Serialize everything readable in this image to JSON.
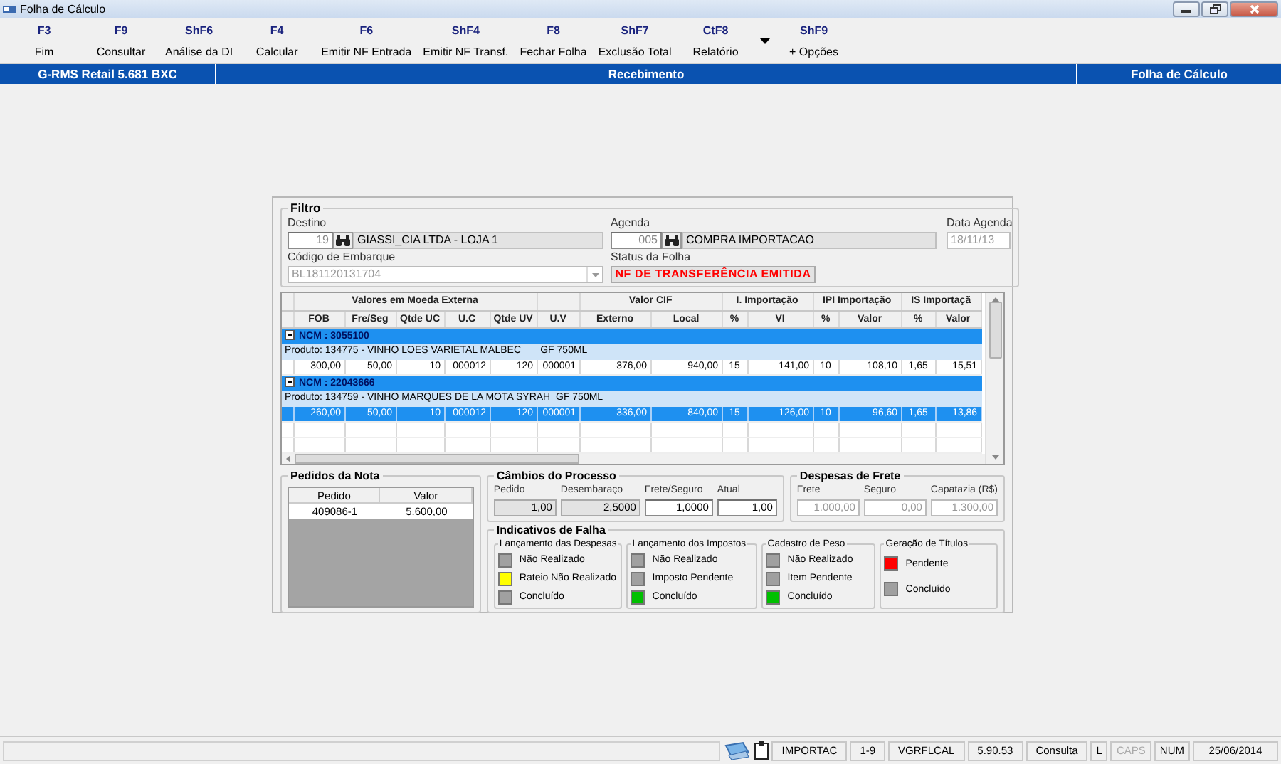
{
  "window": {
    "title": "Folha de Cálculo"
  },
  "toolbar": [
    {
      "key": "F3",
      "label": "Fim",
      "has_menu": false
    },
    {
      "key": "F9",
      "label": "Consultar",
      "has_menu": false
    },
    {
      "key": "ShF6",
      "label": "Análise da DI",
      "has_menu": false
    },
    {
      "key": "F4",
      "label": "Calcular",
      "has_menu": false
    },
    {
      "key": "F6",
      "label": "Emitir NF Entrada",
      "has_menu": false
    },
    {
      "key": "ShF4",
      "label": "Emitir NF Transf.",
      "has_menu": false
    },
    {
      "key": "F8",
      "label": "Fechar Folha",
      "has_menu": false
    },
    {
      "key": "ShF7",
      "label": "Exclusão Total",
      "has_menu": false
    },
    {
      "key": "CtF8",
      "label": "Relatório",
      "has_menu": true
    },
    {
      "key": "ShF9",
      "label": "+ Opções",
      "has_menu": false
    }
  ],
  "header": {
    "left": "G-RMS Retail 5.681 BXC",
    "center": "Recebimento",
    "right": "Folha de Cálculo"
  },
  "filter": {
    "title": "Filtro",
    "destino": {
      "label": "Destino",
      "code": "19",
      "name": "GIASSI_CIA LTDA - LOJA 1"
    },
    "agenda": {
      "label": "Agenda",
      "code": "005",
      "name": "COMPRA IMPORTACAO"
    },
    "data_agenda": {
      "label": "Data Agenda",
      "value": "18/11/13"
    },
    "embarque": {
      "label": "Código de Embarque",
      "value": "BL181120131704"
    },
    "status": {
      "label": "Status da Folha",
      "value": "NF DE TRANSFERÊNCIA EMITIDA"
    }
  },
  "grid": {
    "groups": [
      {
        "label": "Valores em Moeda Externa",
        "columns": [
          "FOB",
          "Fre/Seg",
          "Qtde UC",
          "U.C",
          "Qtde UV"
        ]
      },
      {
        "columns": [
          "U.V"
        ]
      },
      {
        "label": "Valor CIF",
        "columns": [
          "Externo",
          "Local"
        ]
      },
      {
        "label": "I. Importação",
        "columns": [
          "%",
          "VI"
        ]
      },
      {
        "label": "IPI Importação",
        "columns": [
          "%",
          "Valor"
        ]
      },
      {
        "label": "IS Importaçã",
        "columns": [
          "%",
          "Valor"
        ]
      }
    ],
    "rows": [
      {
        "kind": "group",
        "label": "NCM : 3055100",
        "expanded": true
      },
      {
        "kind": "product",
        "label": "Produto: 134775 - VINHO LOES VARIETAL MALBEC       GF 750ML"
      },
      {
        "kind": "data",
        "selected": false,
        "cells": [
          "300,00",
          "50,00",
          "10",
          "000012",
          "120",
          "000001",
          "376,00",
          "940,00",
          "15",
          "141,00",
          "10",
          "108,10",
          "1,65",
          "15,51"
        ]
      },
      {
        "kind": "group",
        "label": "NCM : 22043666",
        "expanded": true
      },
      {
        "kind": "product",
        "label": "Produto: 134759 - VINHO MARQUES DE LA MOTA SYRAH  GF 750ML"
      },
      {
        "kind": "data",
        "selected": true,
        "cells": [
          "260,00",
          "50,00",
          "10",
          "000012",
          "120",
          "000001",
          "336,00",
          "840,00",
          "15",
          "126,00",
          "10",
          "96,60",
          "1,65",
          "13,86"
        ]
      }
    ]
  },
  "pedidos": {
    "title": "Pedidos da Nota",
    "columns": [
      "Pedido",
      "Valor"
    ],
    "rows": [
      [
        "409086-1",
        "5.600,00"
      ]
    ]
  },
  "cambios": {
    "title": "Câmbios do Processo",
    "fields": [
      {
        "label": "Pedido",
        "value": "1,00",
        "readonly": true
      },
      {
        "label": "Desembaraço",
        "value": "2,5000",
        "readonly": true
      },
      {
        "label": "Frete/Seguro",
        "value": "1,0000",
        "readonly": false
      },
      {
        "label": "Atual",
        "value": "1,00",
        "readonly": false
      }
    ]
  },
  "despesas": {
    "title": "Despesas de Frete",
    "fields": [
      {
        "label": "Frete",
        "value": "1.000,00",
        "disabled": true
      },
      {
        "label": "Seguro",
        "value": "0,00",
        "disabled": true
      },
      {
        "label": "Capatazia (R$)",
        "value": "1.300,00",
        "disabled": true
      }
    ]
  },
  "indicativos": {
    "title": "Indicativos de Falha",
    "groups": [
      {
        "title": "Lançamento das Despesas",
        "items": [
          {
            "label": "Não Realizado",
            "color": "#a0a0a0"
          },
          {
            "label": "Rateio Não Realizado",
            "color": "#ffff00"
          },
          {
            "label": "Concluído",
            "color": "#a0a0a0"
          }
        ]
      },
      {
        "title": "Lançamento dos Impostos",
        "items": [
          {
            "label": "Não Realizado",
            "color": "#a0a0a0"
          },
          {
            "label": "Imposto Pendente",
            "color": "#a0a0a0"
          },
          {
            "label": "Concluído",
            "color": "#00c000"
          }
        ]
      },
      {
        "title": "Cadastro de Peso",
        "items": [
          {
            "label": "Não Realizado",
            "color": "#a0a0a0"
          },
          {
            "label": "Item Pendente",
            "color": "#a0a0a0"
          },
          {
            "label": "Concluído",
            "color": "#00c000"
          }
        ]
      },
      {
        "title": "Geração de Títulos",
        "items": [
          {
            "label": "Pendente",
            "color": "#ff0000"
          },
          {
            "label": "Concluído",
            "color": "#a0a0a0"
          }
        ]
      }
    ]
  },
  "status_bar": {
    "cells": [
      "IMPORTAC",
      "1-9",
      "VGRFLCAL",
      "5.90.53",
      "Consulta"
    ],
    "keys": [
      {
        "label": "L",
        "on": true
      },
      {
        "label": "CAPS",
        "on": false
      },
      {
        "label": "NUM",
        "on": true
      }
    ],
    "date": "25/06/2014"
  }
}
